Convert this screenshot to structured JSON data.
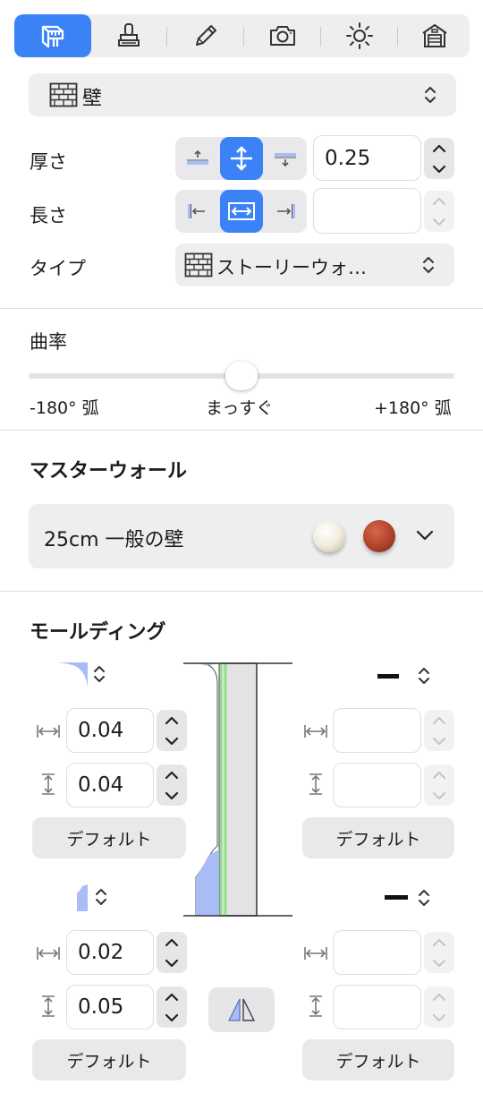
{
  "toolbar": {
    "items": [
      {
        "icon": "wall-tool-icon",
        "active": true
      },
      {
        "icon": "stamp-tool-icon",
        "active": false
      },
      {
        "icon": "pencil-tool-icon",
        "active": false
      },
      {
        "icon": "camera-tool-icon",
        "active": false
      },
      {
        "icon": "sun-tool-icon",
        "active": false
      },
      {
        "icon": "building-tool-icon",
        "active": false
      }
    ]
  },
  "object_select": {
    "label": "壁",
    "icon": "brick-wall-icon"
  },
  "thickness": {
    "label": "厚さ",
    "value": "0.25"
  },
  "length": {
    "label": "長さ",
    "value": ""
  },
  "type": {
    "label": "タイプ",
    "value": "ストーリーウォ…",
    "icon": "brick-wall-icon"
  },
  "curvature": {
    "label": "曲率",
    "min_label": "-180° 弧",
    "mid_label": "まっすぐ",
    "max_label": "+180° 弧",
    "value": 0
  },
  "master_wall": {
    "heading": "マスターウォール",
    "value": "25cm 一般の壁",
    "swatch_colors": [
      "#f2efe0",
      "#b4452c"
    ]
  },
  "molding": {
    "heading": "モールディング",
    "top_left": {
      "width": "0.04",
      "height": "0.04",
      "default_label": "デフォルト"
    },
    "top_right": {
      "width": "",
      "height": "",
      "default_label": "デフォルト"
    },
    "bottom_left": {
      "width": "0.02",
      "height": "0.05",
      "default_label": "デフォルト"
    },
    "bottom_right": {
      "width": "",
      "height": "",
      "default_label": "デフォルト"
    }
  },
  "colors": {
    "accent": "#3b82f6",
    "molding_fill": "#a9bcf5",
    "guide_green": "#8fe08a"
  }
}
